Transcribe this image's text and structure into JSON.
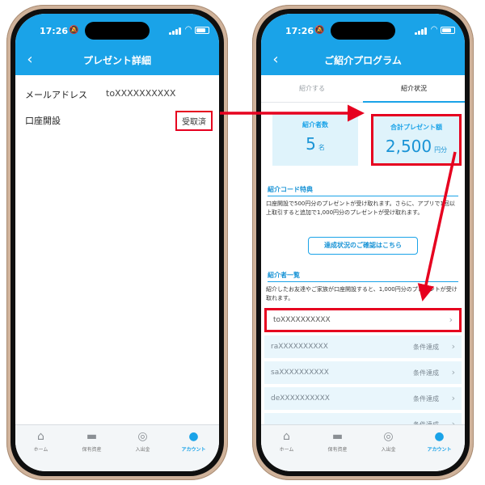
{
  "status_time": "17:26",
  "left": {
    "title": "プレゼント詳細",
    "rows": [
      {
        "key": "メールアドレス",
        "value": "toXXXXXXXXXX"
      },
      {
        "key": "口座開設",
        "value": "受取済"
      }
    ]
  },
  "right": {
    "title": "ご紹介プログラム",
    "tabs": [
      "紹介する",
      "紹介状況"
    ],
    "stats": {
      "referrals_label": "紹介者数",
      "referrals_value": "5",
      "referrals_unit": "名",
      "total_label": "合計プレゼント額",
      "total_value": "2,500",
      "total_unit": "円分"
    },
    "code_section": {
      "title": "紹介コード特典",
      "text": "口座開設で500円分のプレゼントが受け取れます。さらに、アプリで1回以上取引すると追加で1,000円分のプレゼントが受け取れます。",
      "button": "達成状況のご確認はこちら"
    },
    "list_section": {
      "title": "紹介者一覧",
      "text": "紹介したお友達やご家族が口座開設すると、1,000円分のプレゼントが受け取れます。"
    },
    "referrals": [
      {
        "name": "toXXXXXXXXXX",
        "status": ""
      },
      {
        "name": "raXXXXXXXXXX",
        "status": "条件達成"
      },
      {
        "name": "saXXXXXXXXXX",
        "status": "条件達成"
      },
      {
        "name": "deXXXXXXXXXX",
        "status": "条件達成"
      },
      {
        "name": "",
        "status": "条件達成"
      }
    ]
  },
  "tabbar": [
    "ホーム",
    "保有資産",
    "入出金",
    "アカウント"
  ],
  "colors": {
    "brand": "#1aa3e8",
    "highlight": "#e6001f",
    "frame": "#cfb29a"
  }
}
